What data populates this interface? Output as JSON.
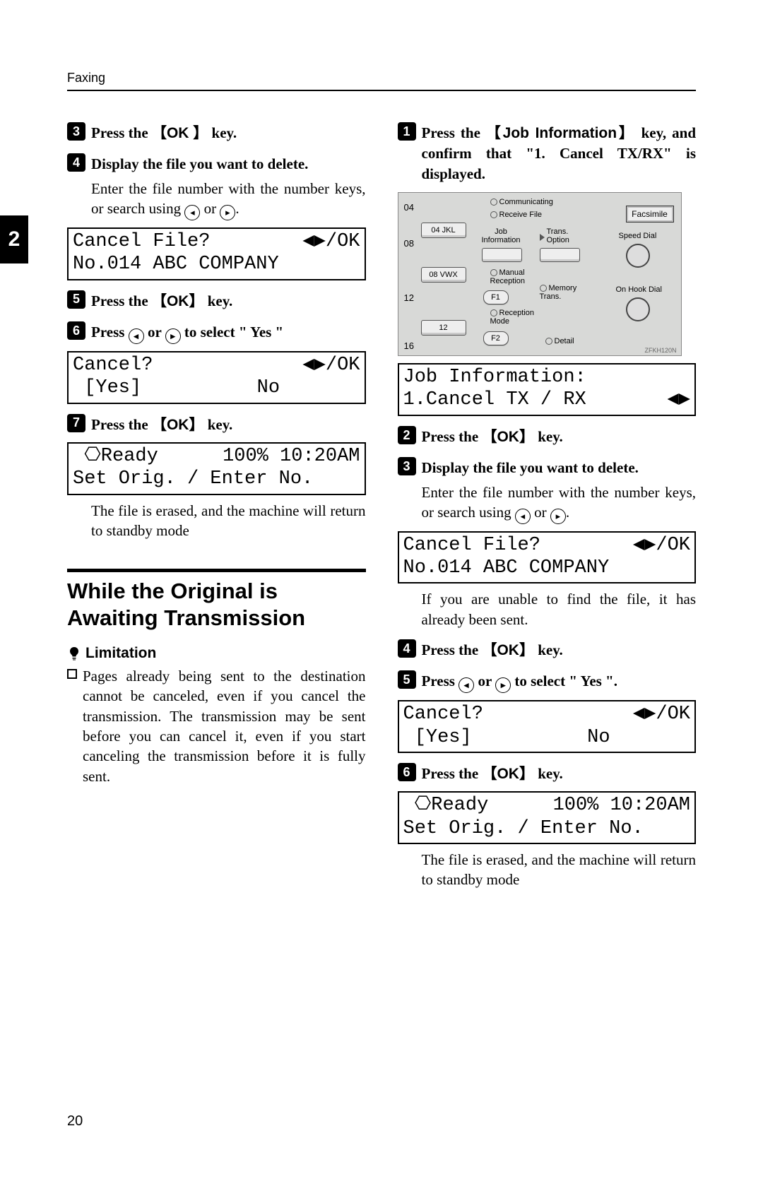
{
  "header": "Faxing",
  "page_number": "20",
  "chapter_tab": "2",
  "left": {
    "step3": "Press the ",
    "step3_key_open": "【",
    "step3_key": "OK",
    "step3_key_close": " 】",
    "step3_tail": "key.",
    "step4": "Display the file you want to delete.",
    "step4_body_a": "Enter the file number with the number keys, or search using ",
    "step4_body_b": " or ",
    "step4_body_c": ".",
    "lcd1_r1_l": "Cancel File?",
    "lcd1_r1_r": "◀▶/OK",
    "lcd1_r2": "No.014 ABC COMPANY",
    "step5": "Press the ",
    "step5_key_open": "【",
    "step5_key": "OK",
    "step5_key_close": "】",
    "step5_tail": " key.",
    "step6_a": "Press ",
    "step6_b": " or ",
    "step6_c": " to select \" Yes \"",
    "lcd2_r1_l": "Cancel?",
    "lcd2_r1_r": "◀▶/OK",
    "lcd2_r2_l": " [Yes]",
    "lcd2_r2_r": "No       ",
    "step7": "Press the ",
    "step7_key_open": "【",
    "step7_key": "OK",
    "step7_key_close": "】",
    "step7_tail": " key.",
    "lcd3_r1_l": " ⎔Ready",
    "lcd3_r1_r": "100% 10:20AM",
    "lcd3_r2": "Set Orig. / Enter No.",
    "after7": "The file is erased, and the machine will return to standby mode",
    "section_title": "While the Original is Awaiting Transmission",
    "limitation_label": "Limitation",
    "limitation_text": "Pages already being sent to the destination cannot be canceled, even if you cancel the transmission. The transmission may be sent before you can cancel it, even if you start canceling the transmission before it is fully sent."
  },
  "right": {
    "step1_a": "Press the ",
    "step1_key_open": "【",
    "step1_key": "Job Information",
    "step1_key_close": "】",
    "step1_b": " key, and confirm that \"1. Cancel TX/RX\" is displayed.",
    "lcdA_r1": "Job Information:",
    "lcdA_r2_l": "1.Cancel TX / RX",
    "lcdA_r2_r": "◀▶",
    "step2": "Press the ",
    "step2_key_open": "【",
    "step2_key": "OK",
    "step2_key_close": "】",
    "step2_tail": " key.",
    "step3": "Display the file you want to delete.",
    "step3_body_a": "Enter the file number with the number keys, or search using ",
    "step3_body_b": " or ",
    "step3_body_c": ".",
    "lcdB_r1_l": "Cancel File?",
    "lcdB_r1_r": "◀▶/OK",
    "lcdB_r2": "No.014 ABC COMPANY",
    "afterB": "If you are unable to find the file, it has already been sent.",
    "step4": "Press the ",
    "step4_key_open": "【",
    "step4_key": "OK",
    "step4_key_close": "】",
    "step4_tail": " key.",
    "step5_a": "Press ",
    "step5_b": " or ",
    "step5_c": " to select \" Yes \".",
    "lcdC_r1_l": "Cancel?",
    "lcdC_r1_r": "◀▶/OK",
    "lcdC_r2_l": " [Yes]",
    "lcdC_r2_r": "No       ",
    "step6": "Press the ",
    "step6_key_open": "【",
    "step6_key": "OK",
    "step6_key_close": "】",
    "step6_tail": " key.",
    "lcdD_r1_l": " ⎔Ready",
    "lcdD_r1_r": "100% 10:20AM",
    "lcdD_r2": "Set Orig. / Enter No.",
    "afterD": "The file is erased, and the machine will return to standby mode"
  },
  "panel": {
    "communicating": "Communicating",
    "receive_file": "Receive File",
    "facsimile": "Facsimile",
    "job_info": "Job\nInformation",
    "trans_option": "Trans.\nOption",
    "speed_dial": "Speed Dial",
    "manual_rec": "Manual\nReception",
    "memory_trans": "Memory\nTrans.",
    "on_hook": "On Hook Dial",
    "reception_mode": "Reception\nMode",
    "detail": "Detail",
    "q04": "04  JKL",
    "q08": "08  VWX",
    "q12": "12",
    "f1": "F1",
    "f2": "F2",
    "n04": "04",
    "n08": "08",
    "n12": "12",
    "n16": "16",
    "code": "ZFKH120N"
  }
}
